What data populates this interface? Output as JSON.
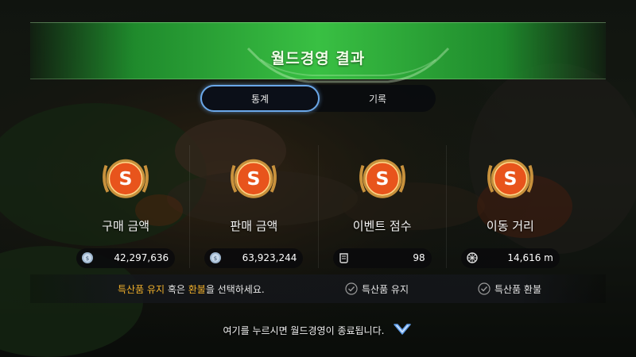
{
  "banner": {
    "title": "월드경영 결과"
  },
  "tabs": [
    {
      "label": "통계",
      "active": true
    },
    {
      "label": "기록",
      "active": false
    }
  ],
  "stats": [
    {
      "label": "구매 금액",
      "medal_letter": "S",
      "value": "42,297,636",
      "icon": "silver-coin-icon"
    },
    {
      "label": "판매 금액",
      "medal_letter": "S",
      "value": "63,923,244",
      "icon": "silver-coin-icon"
    },
    {
      "label": "이벤트 점수",
      "medal_letter": "S",
      "value": "98",
      "icon": "scroll-icon"
    },
    {
      "label": "이동 거리",
      "medal_letter": "S",
      "value": "14,616 m",
      "icon": "wheel-icon"
    }
  ],
  "choice": {
    "prompt_part1": "특산품 유지",
    "prompt_part2": " 혹은 ",
    "prompt_part3": "환불",
    "prompt_part4": "을 선택하세요.",
    "option_keep": "특산품 유지",
    "option_refund": "특산품 환불"
  },
  "footer": {
    "text": "여기를 누르시면 월드경영이 종료됩니다."
  },
  "colors": {
    "banner_green": "#39c043",
    "highlight": "#f2b12b",
    "tab_border": "#6aa7e8",
    "medal_orange": "#e8541c",
    "medal_gold": "#c8913c"
  }
}
